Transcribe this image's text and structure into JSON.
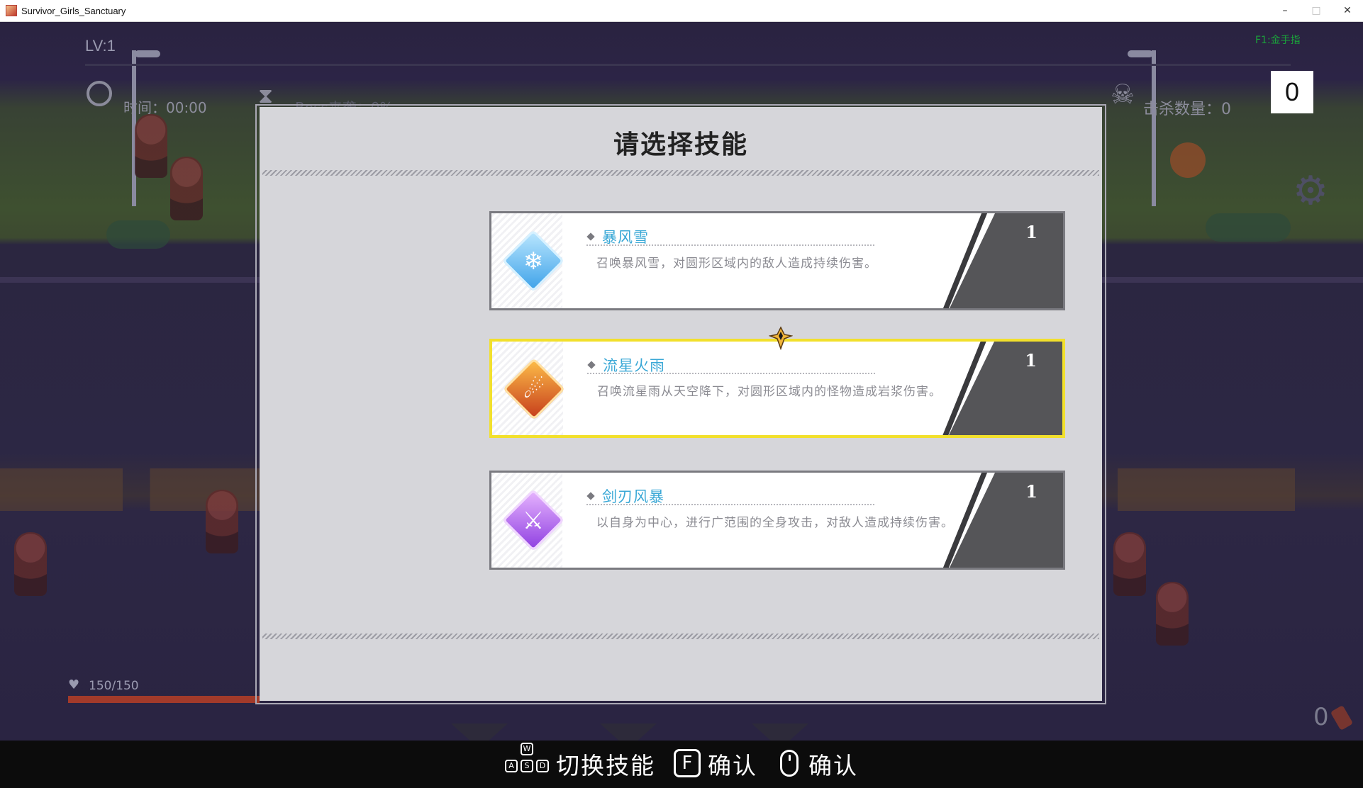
{
  "window": {
    "title": "Survivor_Girls_Sanctuary",
    "buttons": {
      "minimize": "–",
      "maximize": "□",
      "close": "✕"
    }
  },
  "hud": {
    "level": "LV:1",
    "time": "时间：00:00",
    "boss": "Boss来袭：0%",
    "kills": "击杀数量：0",
    "cheat": "F1:金手指",
    "score": "0",
    "hp": "150/150",
    "hp_fraction": 1.0,
    "corner_count": "0"
  },
  "modal": {
    "title": "请选择技能",
    "skills": [
      {
        "name": "暴风雪",
        "desc": "召唤暴风雪，对圆形区域内的敌人造成持续伤害。",
        "level": "1",
        "icon": "snowflake-icon",
        "selected": false
      },
      {
        "name": "流星火雨",
        "desc": "召唤流星雨从天空降下，对圆形区域内的怪物造成岩浆伤害。",
        "level": "1",
        "icon": "meteor-icon",
        "selected": true
      },
      {
        "name": "剑刃风暴",
        "desc": "以自身为中心，进行广范围的全身攻击，对敌人造成持续伤害。",
        "level": "1",
        "icon": "blade-storm-icon",
        "selected": false
      }
    ]
  },
  "controls": {
    "keys": {
      "w": "W",
      "a": "A",
      "s": "S",
      "d": "D",
      "f": "F"
    },
    "switch_label": "切换技能",
    "confirm_key_label": "确认",
    "confirm_mouse_label": "确认"
  },
  "colors": {
    "selected_border": "#f2e02c",
    "skill_name": "#3aa8d6",
    "cheat_text": "#1aa33a"
  }
}
